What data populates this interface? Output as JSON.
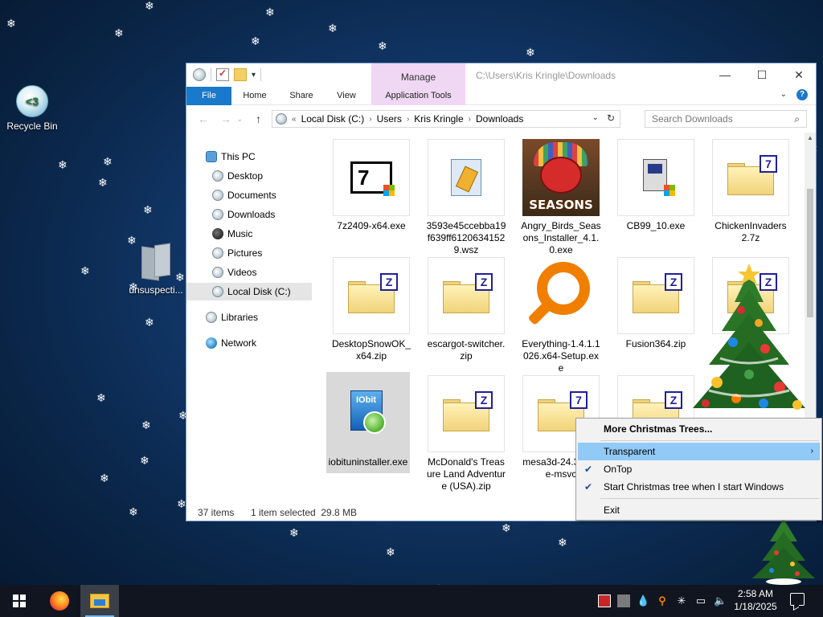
{
  "desktop": {
    "icons": [
      {
        "label": "Recycle Bin"
      },
      {
        "label": "unsuspecti..."
      }
    ],
    "recycle_glyph": "<3"
  },
  "explorer": {
    "title_path": "C:\\Users\\Kris Kringle\\Downloads",
    "manage_label": "Manage",
    "ribbon_tabs": [
      "File",
      "Home",
      "Share",
      "View",
      "Application Tools"
    ],
    "breadcrumb": {
      "overflow": "«",
      "parts": [
        "Local Disk (C:)",
        "Users",
        "Kris Kringle",
        "Downloads"
      ]
    },
    "search_placeholder": "Search Downloads",
    "nav": [
      {
        "label": "This PC",
        "icon": "pc-icon"
      },
      {
        "label": "Desktop",
        "icon": "disk-icon"
      },
      {
        "label": "Documents",
        "icon": "disk-icon"
      },
      {
        "label": "Downloads",
        "icon": "disk-icon"
      },
      {
        "label": "Music",
        "icon": "music-icon"
      },
      {
        "label": "Pictures",
        "icon": "disk-icon"
      },
      {
        "label": "Videos",
        "icon": "disk-icon"
      },
      {
        "label": "Local Disk (C:)",
        "icon": "disk-icon",
        "selected": true
      },
      {
        "label": "Libraries",
        "icon": "disk-icon"
      },
      {
        "label": "Network",
        "icon": "network-icon"
      }
    ],
    "files": [
      {
        "name": "7z2409-x64.exe",
        "icon": "7zip-exe-icon"
      },
      {
        "name": "3593e45ccebba19f639ff6120634152 9.wsz",
        "icon": "wsz-file-icon"
      },
      {
        "name": "Angry_Birds_Seasons_Installer_4.1.0.exe",
        "icon": "angry-birds-icon",
        "badge": "SEASONS"
      },
      {
        "name": "CB99_10.exe",
        "icon": "installer-exe-icon"
      },
      {
        "name": "ChickenInvaders 2.7z",
        "icon": "7z-archive-icon"
      },
      {
        "name": "DesktopSnowOK_x64.zip",
        "icon": "zip-archive-icon"
      },
      {
        "name": "escargot-switcher.zip",
        "icon": "zip-archive-icon"
      },
      {
        "name": "Everything-1.4.1.1026.x64-Setup.exe",
        "icon": "everything-search-icon"
      },
      {
        "name": "Fusion364.zip",
        "icon": "zip-archive-icon"
      },
      {
        "name": "",
        "icon": "zip-archive-icon"
      },
      {
        "name": "iobituninstaller.exe",
        "icon": "iobit-installer-icon",
        "selected": true,
        "badge": "IObit"
      },
      {
        "name": "McDonald's Treasure Land Adventure (USA).zip",
        "icon": "zip-archive-icon"
      },
      {
        "name": "mesa3d-24.3 lease-msvc",
        "icon": "7z-archive-icon"
      },
      {
        "name": "",
        "icon": "7z-archive-icon"
      }
    ],
    "status": {
      "item_count": "37 items",
      "selection": "1 item selected  29.8 MB"
    }
  },
  "context_menu": {
    "items": [
      {
        "label": "More Christmas Trees...",
        "bold": true,
        "checked": false
      },
      {
        "label": "Transparent",
        "submenu": true,
        "highlighted": true,
        "checked": false
      },
      {
        "label": "OnTop",
        "checked": true
      },
      {
        "label": "Start Christmas tree when I start Windows",
        "checked": true
      },
      {
        "label": "Exit",
        "checked": false
      }
    ],
    "highlight_color": "#91c9f7"
  },
  "taskbar": {
    "apps": [
      {
        "name": "firefox",
        "active": false
      },
      {
        "name": "file-explorer",
        "active": true
      }
    ],
    "clock": {
      "time": "2:58 AM",
      "date": "1/18/2025"
    },
    "accent": "#76b9ed"
  }
}
